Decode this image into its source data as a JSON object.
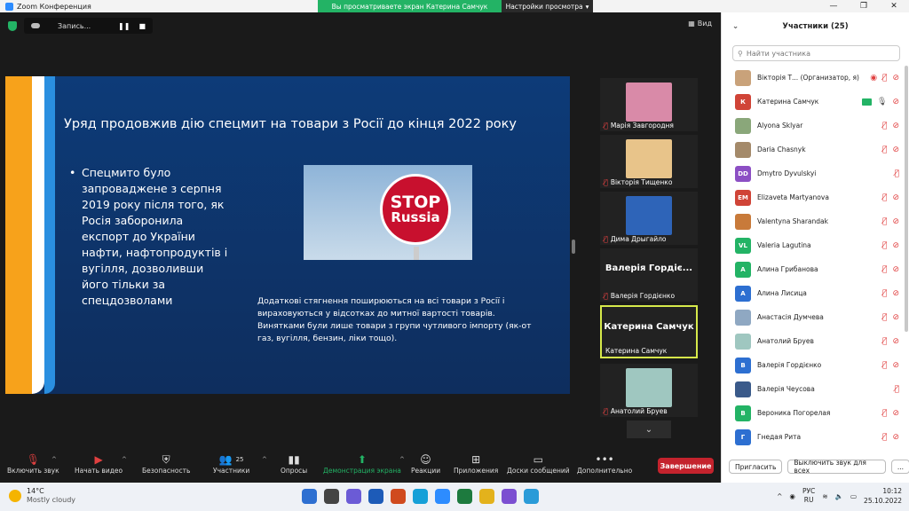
{
  "window": {
    "title": "Zoom Конференция",
    "banner": "Вы просматриваете экран Катерина Самчук",
    "view_settings": "Настройки просмотра"
  },
  "recording": {
    "label": "Запись...",
    "pause": "❚❚",
    "stop": "■"
  },
  "view_label": "Вид",
  "slide": {
    "title": "Уряд продовжив дію спецмит на товари з Росії до кінця 2022 року",
    "bullet": "Спецмито було запроваджене з серпня 2019 року після того, як Росія заборонила експорт до України нафти, нафтопродуктів і вугілля, дозволивши його тільки за спецдозволами",
    "stop_line1": "STOP",
    "stop_line2": "Russia",
    "note": "Додаткові стягнення поширюються на всі товари з Росії і вираховуються у відсотках до митної вартості товарів. Винятками були лише товари з групи чутливого імпорту (як-от газ, вугілля, бензин, ліки тощо)."
  },
  "gallery": [
    {
      "name": "Марія Завгородня",
      "big": "",
      "photo": "#d98aa8"
    },
    {
      "name": "Вікторія Тищенко",
      "big": "",
      "photo": "#e8c48a"
    },
    {
      "name": "Дима Дрыгайло",
      "big": "",
      "photo": "#2e64b8"
    },
    {
      "name": "Валерія Гордієнко",
      "big": "Валерія Гордіє...",
      "photo": ""
    },
    {
      "name": "Катерина Самчук",
      "big": "Катерина Самчук",
      "photo": ""
    },
    {
      "name": "Анатолий Бруев",
      "big": "",
      "photo": "#9fc7c0"
    }
  ],
  "toolbar": {
    "mute": "Включить звук",
    "video": "Начать видео",
    "security": "Безопасность",
    "participants": "Участники",
    "participants_count": "25",
    "polls": "Опросы",
    "share": "Демонстрация экрана",
    "reactions": "Реакции",
    "apps": "Приложения",
    "whiteboards": "Доски сообщений",
    "more": "Дополнительно",
    "end": "Завершение"
  },
  "panel": {
    "title": "Участники (25)",
    "search_placeholder": "Найти участника",
    "invite": "Пригласить",
    "unmute_all": "Выключить звук для всех",
    "more": "..."
  },
  "participants": [
    {
      "name": "Вікторія Т...   (Организатор, я)",
      "initials": "",
      "color": "#c9a27a",
      "extra": "host"
    },
    {
      "name": "Катерина Самчук",
      "initials": "К",
      "color": "#d04437",
      "extra": "share"
    },
    {
      "name": "Alyona Sklyar",
      "initials": "",
      "color": "#8aa77a",
      "extra": ""
    },
    {
      "name": "Daria Chasnyk",
      "initials": "",
      "color": "#a48a6a",
      "extra": ""
    },
    {
      "name": "Dmytro Dyvulskyi",
      "initials": "DD",
      "color": "#8c4fc4",
      "extra": ""
    },
    {
      "name": "Elizaveta Martyanova",
      "initials": "EM",
      "color": "#d04437",
      "extra": ""
    },
    {
      "name": "Valentyna Sharandak",
      "initials": "",
      "color": "#c87a3a",
      "extra": ""
    },
    {
      "name": "Valeria Lagutina",
      "initials": "VL",
      "color": "#23b365",
      "extra": ""
    },
    {
      "name": "Алина Грибанова",
      "initials": "А",
      "color": "#23b365",
      "extra": ""
    },
    {
      "name": "Алина Лисица",
      "initials": "А",
      "color": "#2d6fd1",
      "extra": ""
    },
    {
      "name": "Анастасія Думчева",
      "initials": "",
      "color": "#8fa8c2",
      "extra": ""
    },
    {
      "name": "Анатолий Бруев",
      "initials": "",
      "color": "#9fc7c0",
      "extra": ""
    },
    {
      "name": "Валерія Гордієнко",
      "initials": "В",
      "color": "#2d6fd1",
      "extra": ""
    },
    {
      "name": "Валерія Чеусова",
      "initials": "",
      "color": "#3a5a8a",
      "extra": ""
    },
    {
      "name": "Вероника Погорелая",
      "initials": "В",
      "color": "#23b365",
      "extra": ""
    },
    {
      "name": "Гнедая Рита",
      "initials": "Г",
      "color": "#2d6fd1",
      "extra": ""
    }
  ],
  "taskbar": {
    "temp": "14°C",
    "weather": "Mostly cloudy",
    "lang1": "РУС",
    "lang2": "RU",
    "time": "10:12",
    "date": "25.10.2022"
  }
}
